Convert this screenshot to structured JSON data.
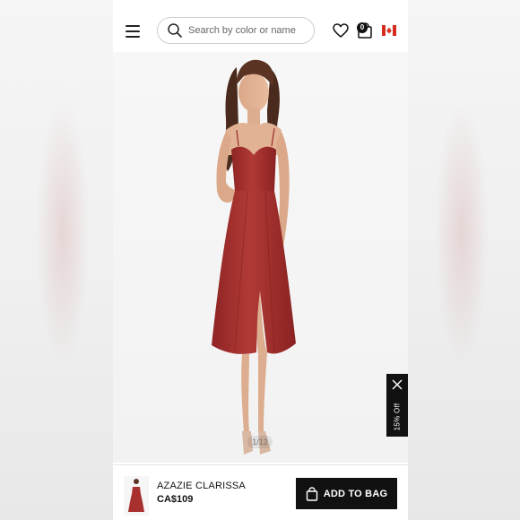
{
  "header": {
    "search_placeholder": "Search by color or name",
    "bag_count": "0"
  },
  "gallery": {
    "image_counter": "1/12",
    "discount_tab": "15% Off"
  },
  "product": {
    "name": "AZAZIE CLARISSA",
    "price": "CA$109",
    "add_to_bag_label": "ADD TO BAG"
  },
  "colors": {
    "dress": "#a8302f",
    "button": "#111111",
    "flag_red": "#d52b1e"
  }
}
